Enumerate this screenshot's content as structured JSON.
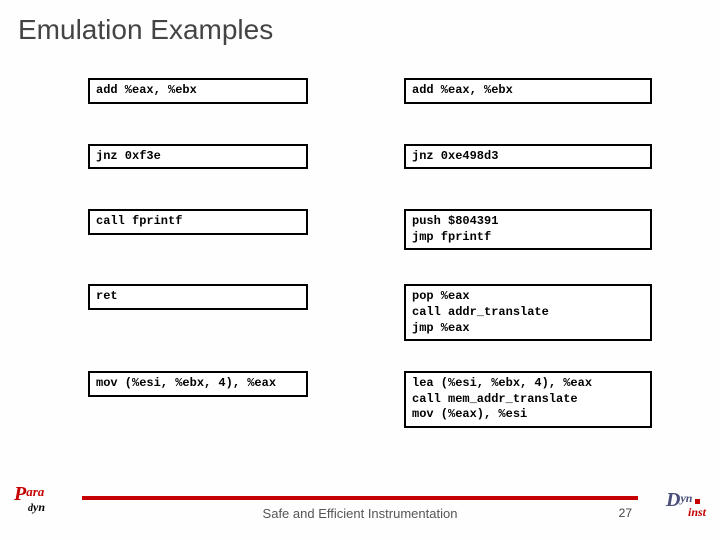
{
  "title": "Emulation Examples",
  "rows": [
    {
      "left": "add %eax, %ebx",
      "right": "add %eax, %ebx"
    },
    {
      "left": "jnz 0xf3e",
      "right": "jnz 0xe498d3"
    },
    {
      "left": "call fprintf",
      "right": "push $804391\njmp fprintf"
    },
    {
      "left": "ret",
      "right": "pop %eax\ncall addr_translate\njmp %eax"
    },
    {
      "left": "mov (%esi, %ebx, 4), %eax",
      "right": "lea (%esi, %ebx, 4), %eax\ncall mem_addr_translate\nmov (%eax), %esi"
    }
  ],
  "footer": {
    "text": "Safe and Efficient Instrumentation",
    "page": "27"
  },
  "logos": {
    "left": {
      "p": "P",
      "ara": "ara",
      "d": "d",
      "yn": "yn"
    },
    "right": {
      "d": "D",
      "yn": "yn",
      "inst": "inst"
    }
  }
}
